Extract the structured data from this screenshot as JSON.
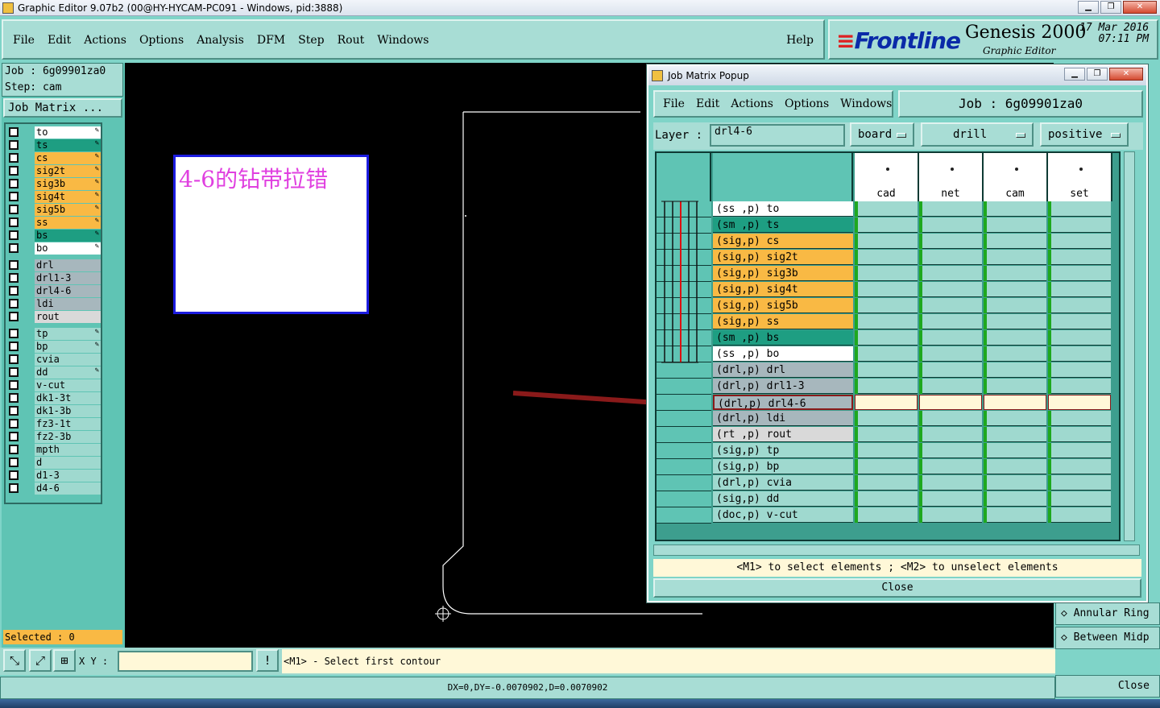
{
  "window": {
    "title": "Graphic Editor 9.07b2 (00@HY-HYCAM-PC091 - Windows, pid:3888)"
  },
  "menubar": {
    "items": [
      "File",
      "Edit",
      "Actions",
      "Options",
      "Analysis",
      "DFM",
      "Step",
      "Rout",
      "Windows"
    ],
    "help": "Help"
  },
  "logo": {
    "brand": "Frontline",
    "product": "Genesis 2000",
    "subtitle": "Graphic Editor",
    "date": "17 Mar 2016",
    "time": "07:11 PM"
  },
  "left": {
    "job": "Job  : 6g09901za0",
    "step": "Step: cam",
    "job_matrix_button": "Job Matrix ...",
    "layers": [
      {
        "name": "to",
        "color": "#ffffff",
        "mark": true
      },
      {
        "name": "ts",
        "color": "#1e9e82",
        "mark": true
      },
      {
        "name": "cs",
        "color": "#f9b944",
        "mark": true
      },
      {
        "name": "sig2t",
        "color": "#f9b944",
        "mark": true
      },
      {
        "name": "sig3b",
        "color": "#f9b944",
        "mark": true
      },
      {
        "name": "sig4t",
        "color": "#f9b944",
        "mark": true
      },
      {
        "name": "sig5b",
        "color": "#f9b944",
        "mark": true
      },
      {
        "name": "ss",
        "color": "#f9b944",
        "mark": true
      },
      {
        "name": "bs",
        "color": "#1e9e82",
        "mark": true
      },
      {
        "name": "bo",
        "color": "#ffffff",
        "mark": true
      },
      {
        "name": "drl",
        "color": "#a7b7bd",
        "mark": false,
        "gap": true
      },
      {
        "name": "drl1-3",
        "color": "#a7b7bd",
        "mark": false
      },
      {
        "name": "drl4-6",
        "color": "#a7b7bd",
        "mark": false
      },
      {
        "name": "ldi",
        "color": "#a7b7bd",
        "mark": false
      },
      {
        "name": "rout",
        "color": "#d9d9d9",
        "mark": false
      },
      {
        "name": "tp",
        "color": "#9fd9cf",
        "mark": true,
        "gap": true
      },
      {
        "name": "bp",
        "color": "#9fd9cf",
        "mark": true
      },
      {
        "name": "cvia",
        "color": "#9fd9cf",
        "mark": false
      },
      {
        "name": "dd",
        "color": "#9fd9cf",
        "mark": true
      },
      {
        "name": "v-cut",
        "color": "#9fd9cf",
        "mark": false
      },
      {
        "name": "dk1-3t",
        "color": "#9fd9cf",
        "mark": false
      },
      {
        "name": "dk1-3b",
        "color": "#9fd9cf",
        "mark": false
      },
      {
        "name": "fz3-1t",
        "color": "#9fd9cf",
        "mark": false
      },
      {
        "name": "fz2-3b",
        "color": "#9fd9cf",
        "mark": false
      },
      {
        "name": "mpth",
        "color": "#9fd9cf",
        "mark": false
      },
      {
        "name": "d",
        "color": "#9fd9cf",
        "mark": false
      },
      {
        "name": "d1-3",
        "color": "#9fd9cf",
        "mark": false
      },
      {
        "name": "d4-6",
        "color": "#9fd9cf",
        "mark": false
      }
    ],
    "selected": "Selected : 0"
  },
  "canvas": {
    "note": "4-6的钻带拉错"
  },
  "bottom": {
    "xy_label": "X Y :",
    "xy_value": "",
    "message": "<M1> - Select first contour",
    "status": "DX=0,DY=-0.0070902,D=0.0070902"
  },
  "right_strip": {
    "items": [
      "Annular Ring",
      "Between Midp"
    ],
    "close": "Close",
    "xy": "X\nY"
  },
  "popup": {
    "title": "Job Matrix Popup",
    "menu": [
      "File",
      "Edit",
      "Actions",
      "Options",
      "Windows"
    ],
    "job": "Job  :  6g09901za0",
    "layer_label": "Layer :",
    "layer_value": "drl4-6",
    "dropdowns": [
      "board",
      "drill",
      "positive"
    ],
    "columns": [
      "cad",
      "net",
      "cam",
      "set"
    ],
    "rows": [
      {
        "name": "(ss ,p) to",
        "color": "#ffffff",
        "bars": [
          1,
          1,
          1,
          1
        ]
      },
      {
        "name": "(sm ,p) ts",
        "color": "#1e9e82",
        "bars": [
          1,
          1,
          1,
          1
        ]
      },
      {
        "name": "(sig,p) cs",
        "color": "#f9b944",
        "bars": [
          1,
          1,
          1,
          1
        ]
      },
      {
        "name": "(sig,p) sig2t",
        "color": "#f9b944",
        "bars": [
          1,
          1,
          1,
          1
        ]
      },
      {
        "name": "(sig,p) sig3b",
        "color": "#f9b944",
        "bars": [
          1,
          1,
          1,
          1
        ]
      },
      {
        "name": "(sig,p) sig4t",
        "color": "#f9b944",
        "bars": [
          1,
          1,
          1,
          1
        ]
      },
      {
        "name": "(sig,p) sig5b",
        "color": "#f9b944",
        "bars": [
          1,
          1,
          1,
          1
        ]
      },
      {
        "name": "(sig,p) ss",
        "color": "#f9b944",
        "bars": [
          1,
          1,
          1,
          1
        ]
      },
      {
        "name": "(sm ,p) bs",
        "color": "#1e9e82",
        "bars": [
          1,
          1,
          1,
          1
        ]
      },
      {
        "name": "(ss ,p) bo",
        "color": "#ffffff",
        "bars": [
          1,
          1,
          1,
          1
        ]
      },
      {
        "name": "(drl,p) drl",
        "color": "#a7b7bd",
        "bars": [
          1,
          1,
          1,
          1
        ]
      },
      {
        "name": "(drl,p) drl1-3",
        "color": "#a7b7bd",
        "bars": [
          1,
          1,
          1,
          1
        ]
      },
      {
        "name": "(drl,p) drl4-6",
        "color": "#a7b7bd",
        "bars": [
          0,
          0,
          0,
          0
        ],
        "hi": true
      },
      {
        "name": "(drl,p) ldi",
        "color": "#a7b7bd",
        "bars": [
          1,
          1,
          1,
          1
        ]
      },
      {
        "name": "(rt ,p) rout",
        "color": "#d9d9d9",
        "bars": [
          1,
          1,
          1,
          1
        ]
      },
      {
        "name": "(sig,p) tp",
        "color": "#9fd9cf",
        "bars": [
          1,
          1,
          1,
          1
        ]
      },
      {
        "name": "(sig,p) bp",
        "color": "#9fd9cf",
        "bars": [
          1,
          1,
          1,
          1
        ]
      },
      {
        "name": "(drl,p) cvia",
        "color": "#9fd9cf",
        "bars": [
          1,
          1,
          1,
          1
        ]
      },
      {
        "name": "(sig,p) dd",
        "color": "#9fd9cf",
        "bars": [
          1,
          1,
          1,
          1
        ]
      },
      {
        "name": "(doc,p) v-cut",
        "color": "#9fd9cf",
        "bars": [
          1,
          1,
          1,
          1
        ]
      }
    ],
    "hint": "<M1> to select elements ; <M2> to unselect elements",
    "close": "Close"
  }
}
